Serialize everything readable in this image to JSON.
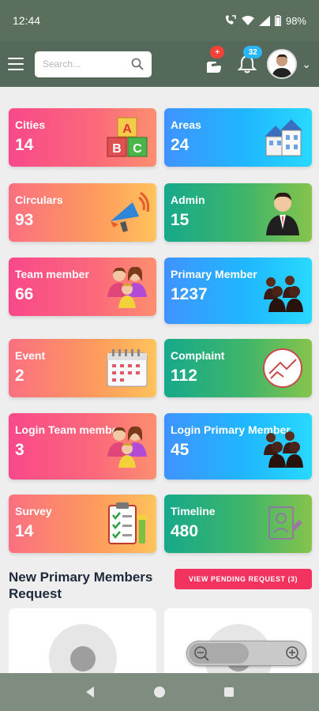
{
  "status_bar": {
    "time": "12:44",
    "battery": "98%"
  },
  "app_bar": {
    "search_placeholder": "Search...",
    "notification_badge": "+",
    "bell_badge": "32"
  },
  "cards": [
    {
      "label": "Cities",
      "value": "14",
      "gradient": "pink",
      "icon": "abc-blocks-icon"
    },
    {
      "label": "Areas",
      "value": "24",
      "gradient": "blue",
      "icon": "building-icon"
    },
    {
      "label": "Circulars",
      "value": "93",
      "gradient": "orange",
      "icon": "megaphone-icon"
    },
    {
      "label": "Admin",
      "value": "15",
      "gradient": "green",
      "icon": "businessman-icon"
    },
    {
      "label": "Team member",
      "value": "66",
      "gradient": "pink",
      "icon": "family-icon"
    },
    {
      "label": "Primary Member",
      "value": "1237",
      "gradient": "blue",
      "icon": "people-group-icon"
    },
    {
      "label": "Event",
      "value": "2",
      "gradient": "orange",
      "icon": "calendar-icon"
    },
    {
      "label": "Complaint",
      "value": "112",
      "gradient": "green",
      "icon": "complaint-icon"
    },
    {
      "label": "Login Team member",
      "value": "3",
      "gradient": "pink",
      "icon": "family-icon"
    },
    {
      "label": "Login Primary Member",
      "value": "45",
      "gradient": "blue",
      "icon": "people-group-icon"
    },
    {
      "label": "Survey",
      "value": "14",
      "gradient": "orange",
      "icon": "clipboard-icon"
    },
    {
      "label": "Timeline",
      "value": "480",
      "gradient": "green",
      "icon": "timeline-icon"
    }
  ],
  "requests_section": {
    "title": "New Primary Members Request",
    "pending_button": "VIEW PENDING REQUEST (3)"
  },
  "colors": {
    "app_bar": "#55695a",
    "pending_button": "#f2335f",
    "bell_badge": "#29b6f6",
    "notif_badge": "#f44336"
  }
}
